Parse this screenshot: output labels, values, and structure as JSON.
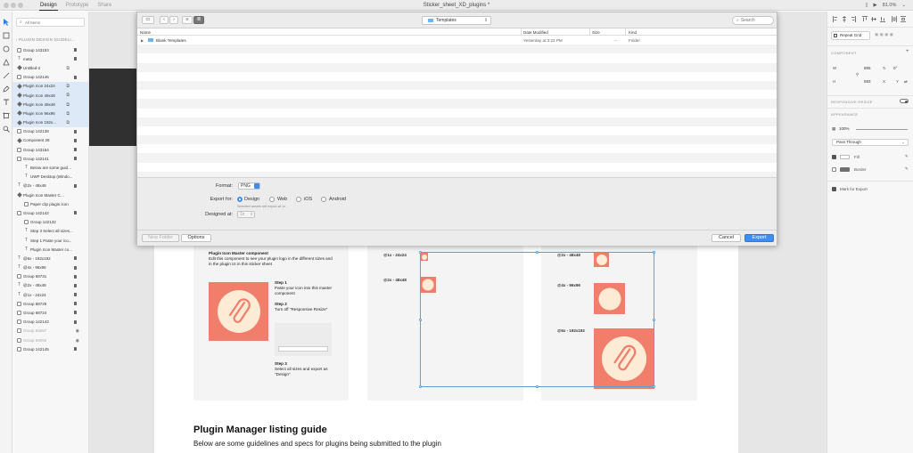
{
  "window": {
    "title": "Sticker_sheet_XD_plugins *",
    "tabs": [
      "Design",
      "Prototype",
      "Share"
    ],
    "zoom": "81.0%"
  },
  "layers": {
    "search_placeholder": "All Items",
    "breadcrumb": "PLUGIN DESIGN GUIDELI...",
    "items": [
      {
        "label": "Group 143153",
        "type": "folder",
        "lock": true,
        "indent": 0
      },
      {
        "label": "meta",
        "type": "text",
        "lock": true,
        "indent": 0
      },
      {
        "label": "Untitled-2",
        "type": "comp",
        "link": true,
        "indent": 0
      },
      {
        "label": "Group 142146",
        "type": "folder",
        "lock": true,
        "indent": 0
      },
      {
        "label": "Plugin Icon 24x24",
        "type": "comp",
        "link": true,
        "sel": true,
        "indent": 0
      },
      {
        "label": "Plugin Icon 48x48",
        "type": "comp",
        "link": true,
        "sel": true,
        "indent": 0
      },
      {
        "label": "Plugin Icon 48x48",
        "type": "comp",
        "link": true,
        "sel": true,
        "indent": 0
      },
      {
        "label": "Plugin Icon 96x96",
        "type": "comp",
        "link": true,
        "sel": true,
        "indent": 0
      },
      {
        "label": "Plugin Icon 192x...",
        "type": "comp",
        "link": true,
        "sel": true,
        "indent": 0
      },
      {
        "label": "Group 142138",
        "type": "folder",
        "lock": true,
        "indent": 0
      },
      {
        "label": "Component 28",
        "type": "comp",
        "lock": true,
        "indent": 0
      },
      {
        "label": "Group 143154",
        "type": "folder",
        "lock": true,
        "indent": 0
      },
      {
        "label": "Group 142141",
        "type": "folder",
        "lock": true,
        "indent": 0
      },
      {
        "label": "Below are some guidel...",
        "type": "text",
        "indent": 1
      },
      {
        "label": "UWP Desktop (Windo...",
        "type": "text",
        "indent": 1
      },
      {
        "label": "@2x - 48x48",
        "type": "text",
        "lock": true,
        "indent": 0
      },
      {
        "label": "Plugin Icon Master Comp...",
        "type": "comp",
        "indent": 0
      },
      {
        "label": "Paper clip plugin icon",
        "type": "folder",
        "indent": 1
      },
      {
        "label": "Group 142142",
        "type": "folder",
        "lock": true,
        "indent": 0
      },
      {
        "label": "Group 142132",
        "type": "folder",
        "indent": 1
      },
      {
        "label": "Step 3 Select all sizes...",
        "type": "text",
        "indent": 1
      },
      {
        "label": "Step 1 Paste your ico...",
        "type": "text",
        "indent": 1
      },
      {
        "label": "Plugin Icon Master co...",
        "type": "text",
        "indent": 1
      },
      {
        "label": "@6x - 192x192",
        "type": "text",
        "lock": true,
        "indent": 0
      },
      {
        "label": "@4x - 96x96",
        "type": "text",
        "lock": true,
        "indent": 0
      },
      {
        "label": "Group 68731",
        "type": "folder",
        "lock": true,
        "indent": 0
      },
      {
        "label": "@2x - 48x48",
        "type": "text",
        "lock": true,
        "indent": 0
      },
      {
        "label": "@1x - 24x24",
        "type": "text",
        "lock": true,
        "indent": 0
      },
      {
        "label": "Group 68725",
        "type": "folder",
        "lock": true,
        "indent": 0
      },
      {
        "label": "Group 68724",
        "type": "folder",
        "lock": true,
        "indent": 0
      },
      {
        "label": "Group 142143",
        "type": "folder",
        "lock": true,
        "indent": 0
      },
      {
        "label": "Group 68267",
        "type": "folder",
        "dim": true,
        "eye": true,
        "indent": 0
      },
      {
        "label": "Group 68260",
        "type": "folder",
        "dim": true,
        "eye": true,
        "indent": 0
      },
      {
        "label": "Group 142145",
        "type": "folder",
        "lock": true,
        "indent": 0
      }
    ]
  },
  "dialog": {
    "location": "Templates",
    "search_placeholder": "Search",
    "columns": {
      "name": "Name",
      "modified": "Date Modified",
      "size": "Size",
      "kind": "Kind"
    },
    "files": [
      {
        "name": "Blank Templates",
        "modified": "Yesterday at 3:23 PM",
        "size": "--",
        "kind": "Folder"
      }
    ],
    "format_label": "Format:",
    "format_value": "PNG",
    "export_for_label": "Export for:",
    "export_options": [
      "Design",
      "Web",
      "iOS",
      "Android"
    ],
    "export_selected": "Design",
    "hint": "Selected assets will export at 1x.",
    "designed_at_label": "Designed at:",
    "designed_at_value": "1x",
    "new_folder": "New Folder",
    "options": "Options",
    "cancel": "Cancel",
    "export": "Export"
  },
  "canvas": {
    "master": {
      "title": "Plugin Icon Master component",
      "body": "Edit this component to see your plugin logo in the different sizes and in the plugin UI in this sticker sheet",
      "step1_title": "Step 1",
      "step1_body": "Paste your icon into this master component",
      "step2_title": "Step 2",
      "step2_body": "Turn off \"Responsive Resize\"",
      "step3_title": "Step 3",
      "step3_body": "Select all sizes and export as \"Design\""
    },
    "sizes_left": [
      "@1x - 24x24",
      "@2x - 48x48"
    ],
    "sizes_right": [
      "@2x - 48x48",
      "@4x - 96x96",
      "@6x - 192x192"
    ],
    "guide_title": "Plugin Manager listing guide",
    "guide_body": "Below are some guidelines and specs for plugins being submitted to the plugin"
  },
  "props": {
    "repeat_grid": "Repeat Grid",
    "component_label": "COMPONENT",
    "w_label": "W",
    "w_value": "855",
    "h_label": "H",
    "h_value": "593",
    "x_label": "X",
    "y_label": "Y",
    "rot_value": "0°",
    "responsive_label": "RESPONSIVE RESIZE",
    "appearance_label": "APPEARANCE",
    "opacity": "100%",
    "blend_mode": "Pass Through",
    "fill_label": "Fill",
    "border_label": "Border",
    "mark_export": "Mark for Export",
    "fill_color": "#ffffff",
    "border_color": "#707070"
  },
  "colors": {
    "accent": "#3d8ef0",
    "icon_bg": "#f07e6b",
    "icon_circle": "#fdebd5",
    "selection": "#5b9fde"
  }
}
